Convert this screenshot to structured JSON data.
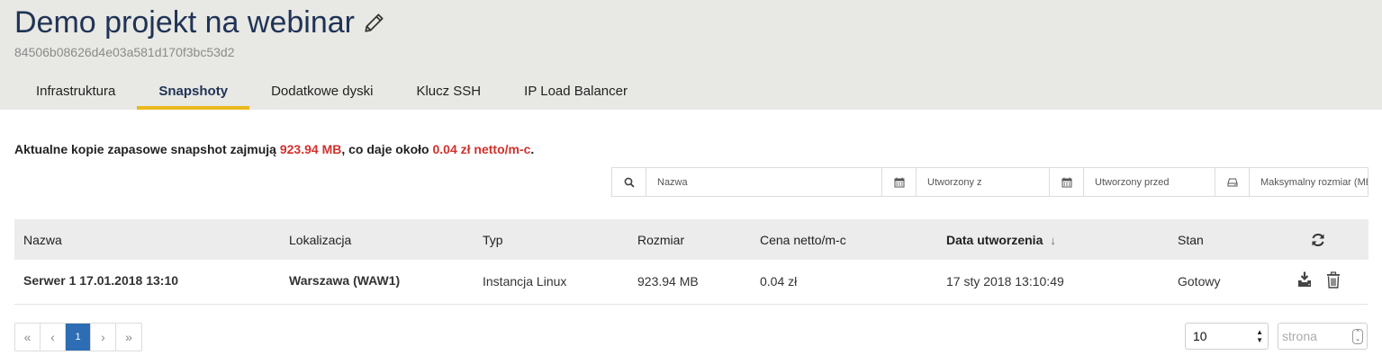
{
  "project": {
    "title": "Demo projekt na webinar",
    "id": "84506b08626d4e03a581d170f3bc53d2"
  },
  "tabs": [
    {
      "label": "Infrastruktura",
      "active": false
    },
    {
      "label": "Snapshoty",
      "active": true
    },
    {
      "label": "Dodatkowe dyski",
      "active": false
    },
    {
      "label": "Klucz SSH",
      "active": false
    },
    {
      "label": "IP Load Balancer",
      "active": false
    }
  ],
  "summary": {
    "prefix": "Aktualne kopie zapasowe snapshot zajmują ",
    "size": "923.94 MB",
    "middle": ", co daje około ",
    "price": "0.04 zł netto/m-c",
    "suffix": "."
  },
  "filters": {
    "name_placeholder": "Nazwa",
    "created_from_placeholder": "Utworzony z",
    "created_before_placeholder": "Utworzony przed",
    "max_size_placeholder": "Maksymalny rozmiar (MB)"
  },
  "table": {
    "headers": {
      "name": "Nazwa",
      "location": "Lokalizacja",
      "type": "Typ",
      "size": "Rozmiar",
      "price": "Cena netto/m-c",
      "created": "Data utworzenia",
      "status": "Stan"
    },
    "sort_icon": "arrow-down-icon",
    "refresh_icon": "refresh-icon",
    "rows": [
      {
        "name": "Serwer 1 17.01.2018 13:10",
        "location": "Warszawa (WAW1)",
        "type": "Instancja Linux",
        "size": "923.94 MB",
        "price": "0.04 zł",
        "created": "17 sty 2018 13:10:49",
        "status": "Gotowy"
      }
    ]
  },
  "pagination": {
    "first": "«",
    "prev": "‹",
    "current": "1",
    "next": "›",
    "last": "»"
  },
  "per_page": {
    "value": "10"
  },
  "page_jump": {
    "placeholder": "strona"
  },
  "colors": {
    "header_bg": "#e8e8e4",
    "title": "#1f3355",
    "accent_tab": "#e9b91d",
    "highlight_red": "#d0312d",
    "pagination_active": "#2c6db3"
  }
}
